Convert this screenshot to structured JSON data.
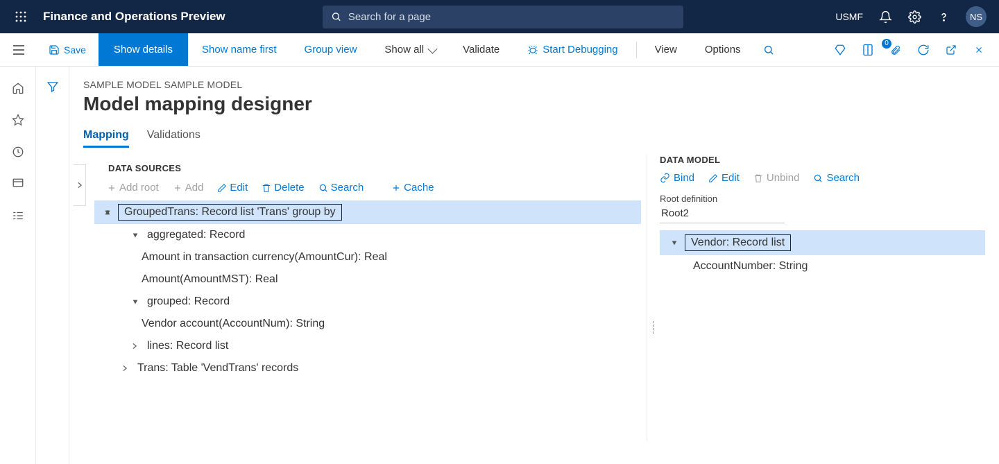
{
  "top": {
    "app_title": "Finance and Operations Preview",
    "search_placeholder": "Search for a page",
    "company": "USMF",
    "avatar_initials": "NS"
  },
  "cmdbar": {
    "save": "Save",
    "show_details": "Show details",
    "show_name_first": "Show name first",
    "group_view": "Group view",
    "show_all": "Show all",
    "validate": "Validate",
    "start_debugging": "Start Debugging",
    "view": "View",
    "options": "Options",
    "badge": "0"
  },
  "page": {
    "breadcrumb": "SAMPLE MODEL SAMPLE MODEL",
    "title": "Model mapping designer",
    "tabs": {
      "mapping": "Mapping",
      "validations": "Validations"
    }
  },
  "ds": {
    "header": "DATA SOURCES",
    "toolbar": {
      "add_root": "Add root",
      "add": "Add",
      "edit": "Edit",
      "delete": "Delete",
      "search": "Search",
      "cache": "Cache"
    },
    "selected": "GroupedTrans: Record list 'Trans' group by",
    "nodes": {
      "aggregated": "aggregated: Record",
      "amount_cur": "Amount in transaction currency(AmountCur): Real",
      "amount_mst": "Amount(AmountMST): Real",
      "grouped": "grouped: Record",
      "vendor_acc": "Vendor account(AccountNum): String",
      "lines": "lines: Record list",
      "trans": "Trans: Table 'VendTrans' records"
    }
  },
  "dm": {
    "header": "DATA MODEL",
    "toolbar": {
      "bind": "Bind",
      "edit": "Edit",
      "unbind": "Unbind",
      "search": "Search"
    },
    "root_def_label": "Root definition",
    "root_def_value": "Root2",
    "selected": "Vendor: Record list",
    "child": "AccountNumber: String"
  }
}
